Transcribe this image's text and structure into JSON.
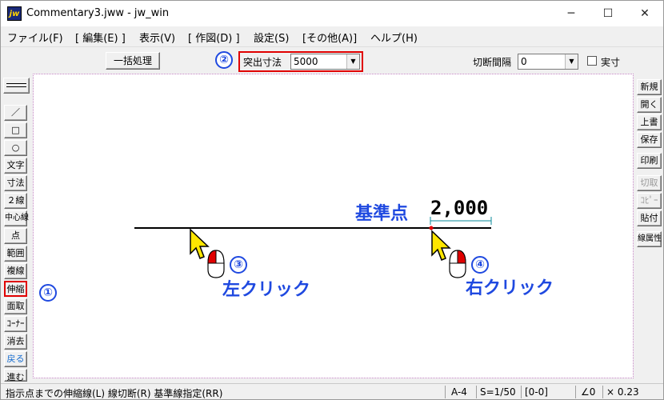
{
  "window": {
    "title": "Commentary3.jww - jw_win",
    "app_icon": "jw",
    "controls": {
      "minimize": "─",
      "maximize": "☐",
      "close": "✕"
    }
  },
  "menu": [
    "ファイル(F)",
    "[ 編集(E) ]",
    "表示(V)",
    "[ 作図(D) ]",
    "設定(S)",
    "[その他(A)]",
    "ヘルプ(H)"
  ],
  "toolbar": {
    "batch_button": "一括処理",
    "protrusion_label": "突出寸法",
    "protrusion_value": "5000",
    "cut_interval_label": "切断間隔",
    "cut_interval_value": "0",
    "actual_size_label": "実寸"
  },
  "left_tools": [
    "／",
    "□",
    "○",
    "文字",
    "寸法",
    "２線",
    "中心線",
    "点",
    "範囲",
    "複線",
    "伸縮",
    "面取",
    "ｺｰﾅｰ",
    "消去",
    "戻る",
    "進む"
  ],
  "right_tools": [
    "新規",
    "開く",
    "上書",
    "保存",
    "印刷",
    "切取",
    "ｺﾋﾟｰ",
    "貼付",
    "線属性"
  ],
  "drawing": {
    "reference_label": "基準点",
    "dimension_text": "2,000",
    "left_click_label": "左クリック",
    "right_click_label": "右クリック"
  },
  "annotations": {
    "n1": "①",
    "n2": "②",
    "n3": "③",
    "n4": "④"
  },
  "status": {
    "message": "指示点までの伸縮線(L) 線切断(R) 基準線指定(RR)",
    "paper": "A-4",
    "scale": "S=1/50",
    "layer": "[0-0]",
    "angle": "∠0",
    "factor": "× 0.23"
  },
  "colors": {
    "annotation_blue": "#1f49e0",
    "highlight_red": "#e00000"
  }
}
